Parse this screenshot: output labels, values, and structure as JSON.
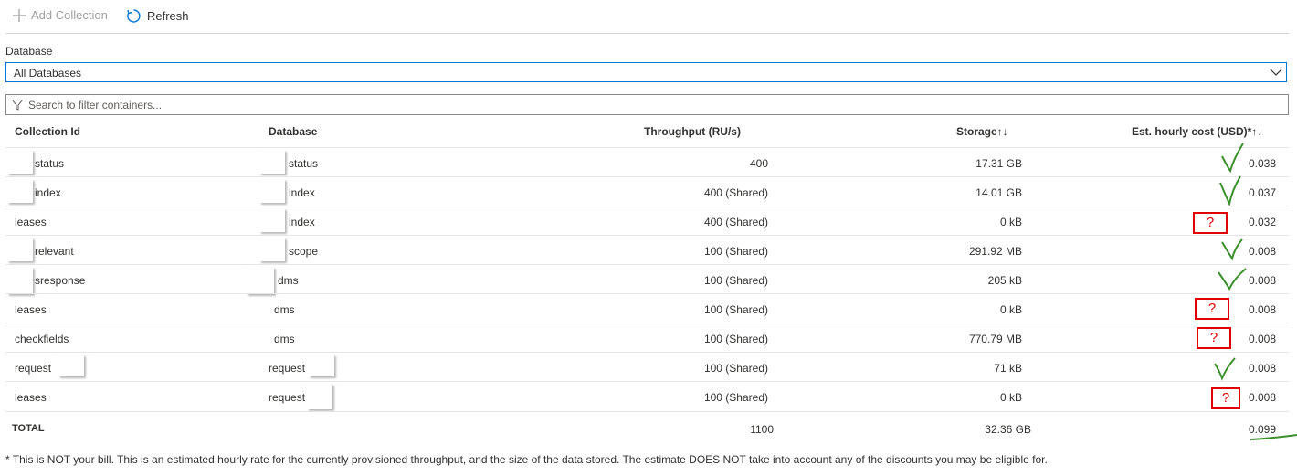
{
  "toolbar": {
    "add_label": "Add Collection",
    "refresh_label": "Refresh"
  },
  "database_filter": {
    "label": "Database",
    "selected": "All Databases"
  },
  "search": {
    "placeholder": "Search to filter containers..."
  },
  "table": {
    "headers": {
      "collection_id": "Collection Id",
      "database": "Database",
      "throughput": "Throughput (RU/s)",
      "storage": "Storage↑↓",
      "cost": "Est. hourly cost (USD)*↑↓"
    },
    "rows": [
      {
        "collection_id": "status",
        "database": "status",
        "throughput": "400",
        "storage": "17.31 GB",
        "cost": "0.038",
        "mark": "check"
      },
      {
        "collection_id": "index",
        "database": "index",
        "throughput": "400 (Shared)",
        "storage": "14.01 GB",
        "cost": "0.037",
        "mark": "check"
      },
      {
        "collection_id": "leases",
        "database": "index",
        "throughput": "400 (Shared)",
        "storage": "0 kB",
        "cost": "0.032",
        "mark": "question",
        "mark_text": "?"
      },
      {
        "collection_id": "relevant",
        "database": "scope",
        "throughput": "100 (Shared)",
        "storage": "291.92 MB",
        "cost": "0.008",
        "mark": "check"
      },
      {
        "collection_id": "sresponse",
        "database": "dms",
        "throughput": "100 (Shared)",
        "storage": "205 kB",
        "cost": "0.008",
        "mark": "check"
      },
      {
        "collection_id": "leases",
        "database": "dms",
        "throughput": "100 (Shared)",
        "storage": "0 kB",
        "cost": "0.008",
        "mark": "question",
        "mark_text": "?"
      },
      {
        "collection_id": "checkfields",
        "database": "dms",
        "throughput": "100 (Shared)",
        "storage": "770.79 MB",
        "cost": "0.008",
        "mark": "question",
        "mark_text": "?"
      },
      {
        "collection_id": "request",
        "database": "request",
        "throughput": "100 (Shared)",
        "storage": "71 kB",
        "cost": "0.008",
        "mark": "check"
      },
      {
        "collection_id": "leases",
        "database": "request",
        "throughput": "100 (Shared)",
        "storage": "0 kB",
        "cost": "0.008",
        "mark": "question",
        "mark_text": "?"
      }
    ],
    "total": {
      "label": "TOTAL",
      "throughput": "1100",
      "storage": "32.36 GB",
      "cost": "0.099"
    }
  },
  "footnote": "* This is NOT your bill. This is an estimated hourly rate for the currently provisioned throughput, and the size of the data stored. The estimate DOES NOT take into account any of the discounts you may be eligible for.",
  "colors": {
    "accent": "#0078d4",
    "check_mark": "#3a8f2a",
    "question_box": "#e00000"
  },
  "icons": {
    "add": "plus-icon",
    "refresh": "refresh-icon",
    "dropdown": "chevron-down-icon",
    "filter": "filter-icon"
  }
}
